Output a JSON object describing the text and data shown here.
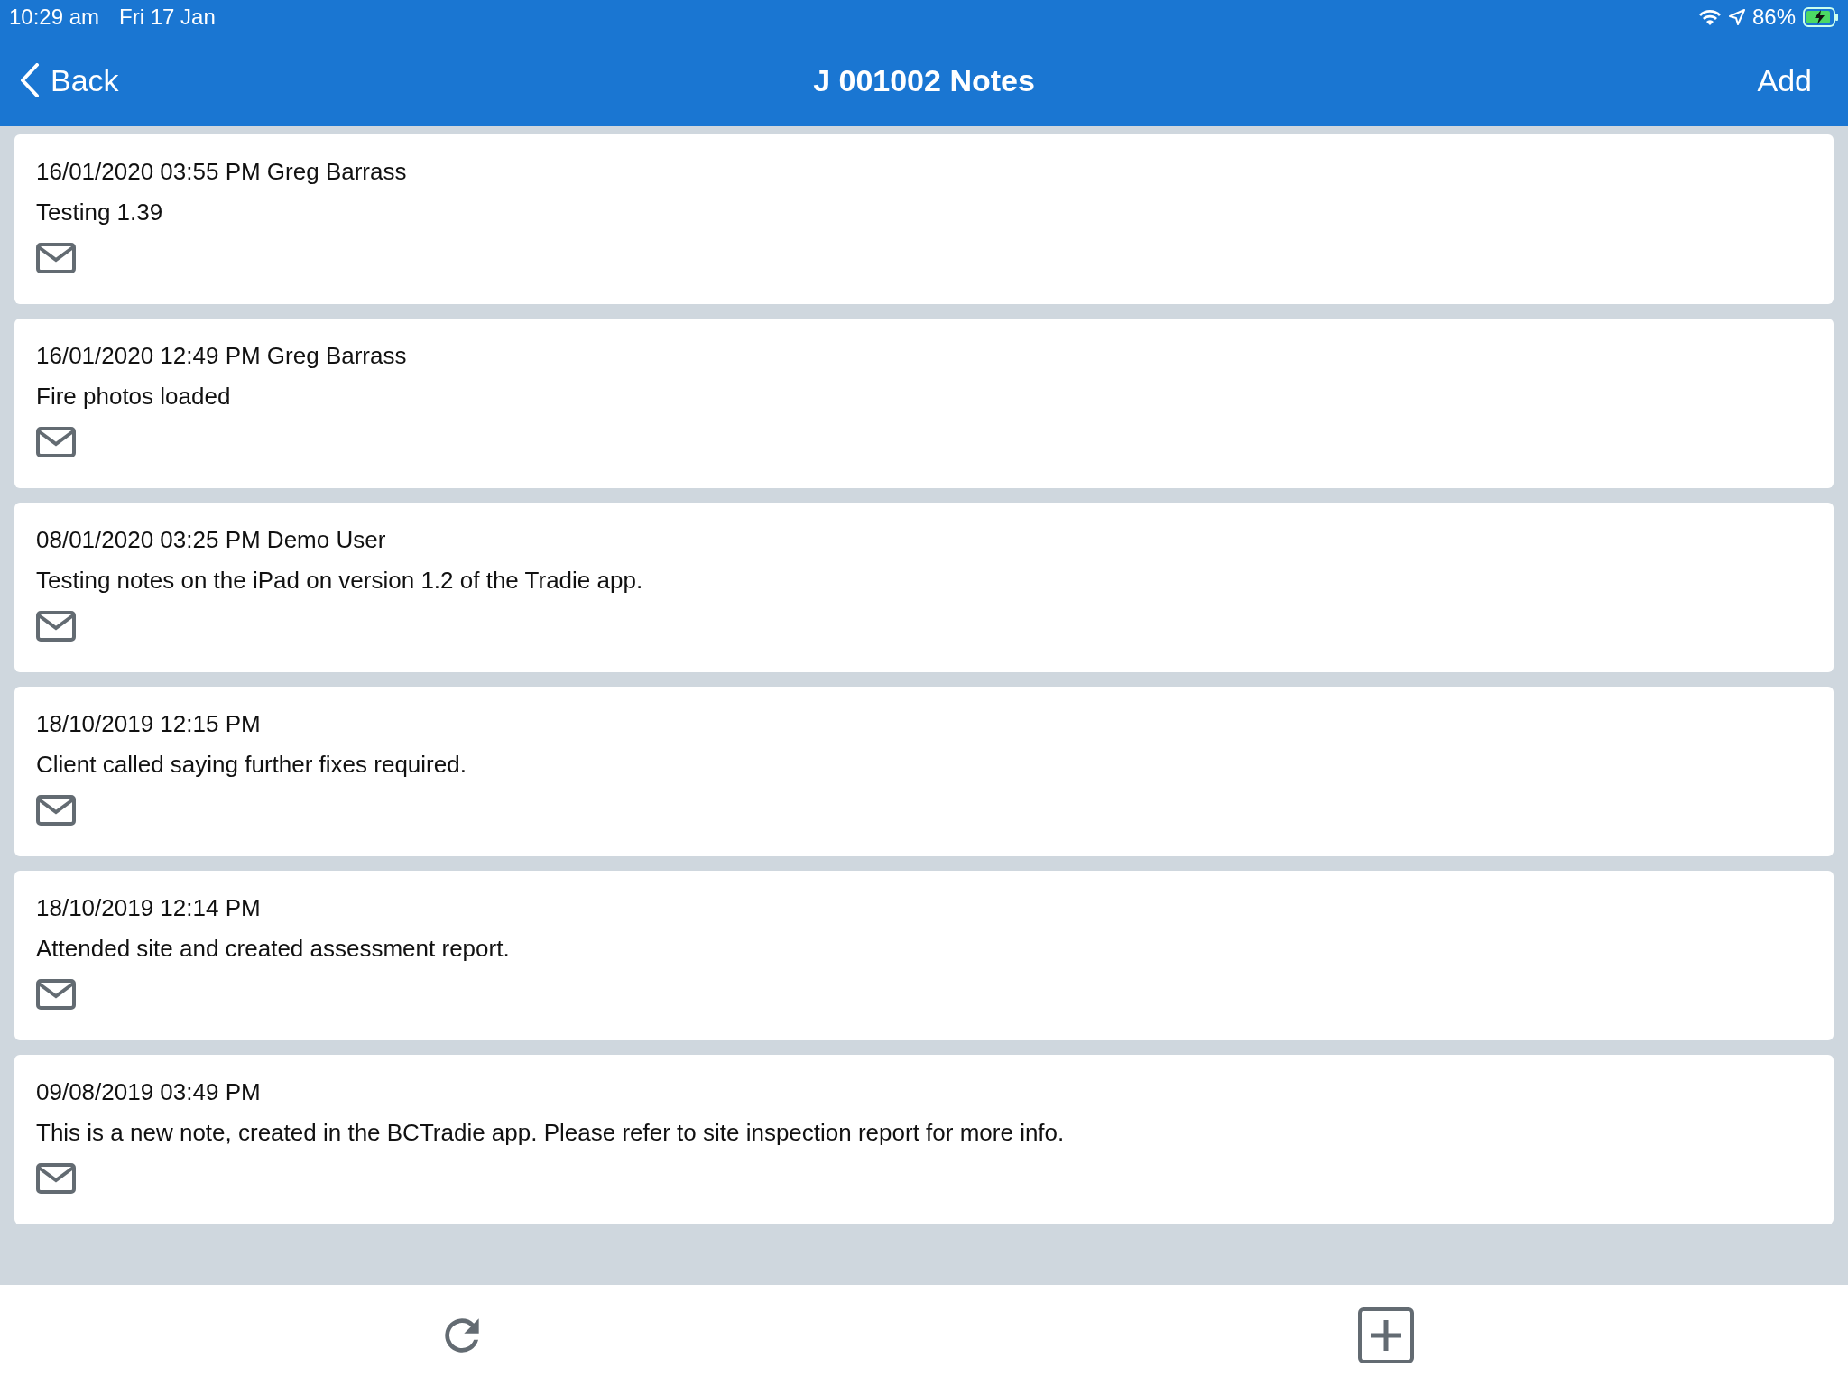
{
  "status_bar": {
    "time": "10:29 am",
    "date": "Fri 17 Jan",
    "battery": "86%"
  },
  "nav_bar": {
    "back": "Back",
    "title": "J 001002 Notes",
    "action": "Add"
  },
  "notes": [
    {
      "header": "16/01/2020 03:55 PM Greg Barrass",
      "text": "Testing 1.39"
    },
    {
      "header": "16/01/2020 12:49 PM Greg Barrass",
      "text": "Fire photos loaded"
    },
    {
      "header": "08/01/2020 03:25 PM Demo User",
      "text": "Testing notes on the iPad on version 1.2 of the Tradie app."
    },
    {
      "header": "18/10/2019 12:15 PM",
      "text": "Client called saying further fixes required."
    },
    {
      "header": "18/10/2019 12:14 PM",
      "text": "Attended site and created assessment report."
    },
    {
      "header": "09/08/2019 03:49 PM",
      "text": "This is a new note, created in the BCTradie app. Please refer to site inspection report for more info."
    }
  ]
}
